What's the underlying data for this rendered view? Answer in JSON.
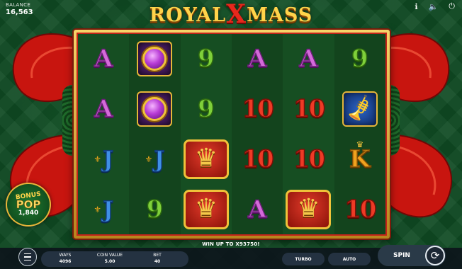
{
  "balance": {
    "label": "BALANCE",
    "value": "16,563"
  },
  "logo": {
    "part1": "ROYAL",
    "part2": "X",
    "part3": "MASS"
  },
  "top_icons": [
    {
      "name": "info-icon",
      "glyph": "ℹ"
    },
    {
      "name": "sound-icon",
      "glyph": "🔈"
    },
    {
      "name": "power-icon",
      "glyph": "⏻"
    }
  ],
  "reels": [
    [
      {
        "type": "A"
      },
      {
        "type": "gem"
      },
      {
        "type": "9"
      },
      {
        "type": "A"
      },
      {
        "type": "A"
      },
      {
        "type": "9"
      }
    ],
    [
      {
        "type": "A"
      },
      {
        "type": "gem"
      },
      {
        "type": "9"
      },
      {
        "type": "10"
      },
      {
        "type": "10"
      },
      {
        "type": "horn"
      }
    ],
    [
      {
        "type": "J"
      },
      {
        "type": "J"
      },
      {
        "type": "crown"
      },
      {
        "type": "10"
      },
      {
        "type": "10"
      },
      {
        "type": "K"
      }
    ],
    [
      {
        "type": "J"
      },
      {
        "type": "9"
      },
      {
        "type": "crown"
      },
      {
        "type": "A"
      },
      {
        "type": "crown"
      },
      {
        "type": "10"
      }
    ]
  ],
  "bonus_pop": {
    "line1": "BONUS",
    "line2": "POP",
    "value": "1,840"
  },
  "win_text": "WIN UP TO X93750!",
  "footer": {
    "ways_label": "WAYS",
    "ways_value": "4096",
    "coin_label": "COIN VALUE",
    "coin_value": "5.00",
    "bet_label": "BET",
    "bet_value": "40",
    "turbo_label": "TURBO",
    "auto_label": "AUTO",
    "spin_label": "SPIN"
  },
  "colors": {
    "frame_gold": "#f7d46a",
    "frame_red": "#c4231a",
    "ribbon_red": "#c8150f",
    "bg_green": "#0f4a22"
  }
}
